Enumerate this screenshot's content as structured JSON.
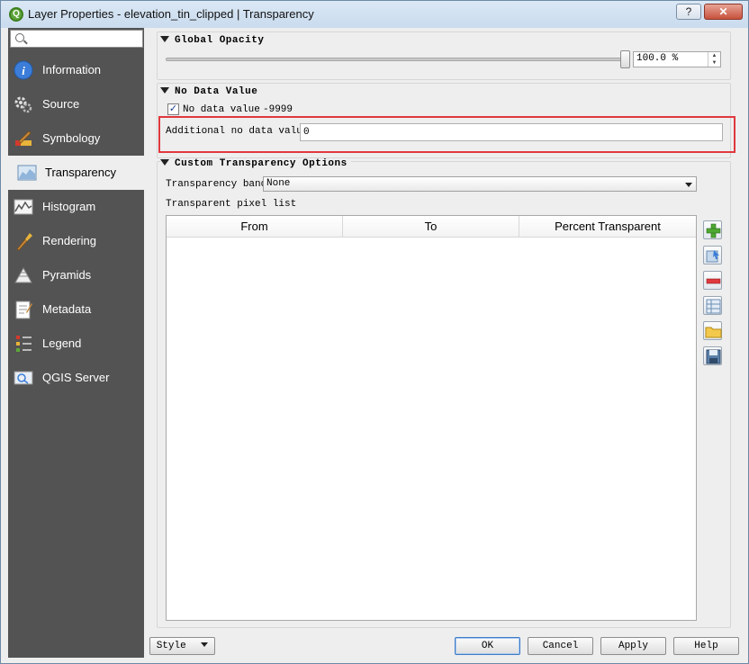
{
  "window": {
    "title": "Layer Properties - elevation_tin_clipped | Transparency",
    "help_label": "?",
    "close_label": "✕"
  },
  "sidebar": {
    "search_value": "",
    "items": [
      {
        "label": "Information",
        "icon": "information-icon"
      },
      {
        "label": "Source",
        "icon": "source-icon"
      },
      {
        "label": "Symbology",
        "icon": "symbology-icon"
      },
      {
        "label": "Transparency",
        "icon": "transparency-icon"
      },
      {
        "label": "Histogram",
        "icon": "histogram-icon"
      },
      {
        "label": "Rendering",
        "icon": "rendering-icon"
      },
      {
        "label": "Pyramids",
        "icon": "pyramids-icon"
      },
      {
        "label": "Metadata",
        "icon": "metadata-icon"
      },
      {
        "label": "Legend",
        "icon": "legend-icon"
      },
      {
        "label": "QGIS Server",
        "icon": "qgis-server-icon"
      }
    ],
    "active_item": "Transparency"
  },
  "global_opacity": {
    "title": "Global Opacity",
    "value": "100.0 %",
    "level_percent": 100
  },
  "no_data": {
    "title": "No Data Value",
    "checkbox_label": "No data value",
    "checked": true,
    "value": "-9999",
    "additional_label": "Additional no data value",
    "additional_value": "0"
  },
  "custom_transparency": {
    "title": "Custom Transparency Options",
    "band_label": "Transparency band",
    "band_value": "None",
    "list_label": "Transparent pixel list",
    "columns": [
      "From",
      "To",
      "Percent Transparent"
    ],
    "rows": []
  },
  "toolbar_icons": [
    "add-value-icon",
    "add-values-from-display-icon",
    "remove-icon",
    "default-values-icon",
    "import-file-icon",
    "export-file-icon"
  ],
  "buttons": {
    "style": "Style",
    "ok": "OK",
    "cancel": "Cancel",
    "apply": "Apply",
    "help": "Help"
  },
  "colors": {
    "sidebar_bg": "#535353",
    "highlight": "#e0393e",
    "qgis_green": "#5ea63a"
  }
}
